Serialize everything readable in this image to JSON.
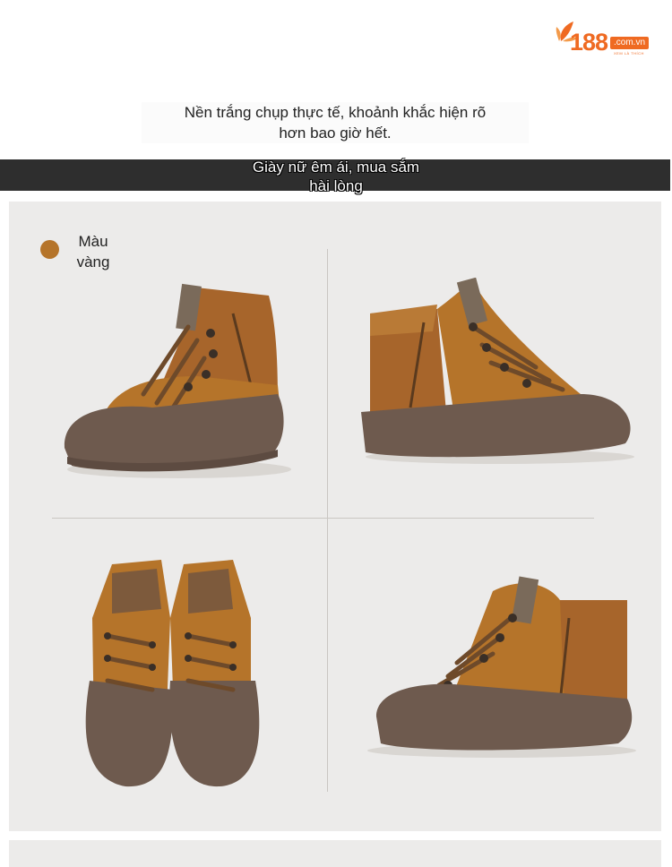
{
  "logo": {
    "number": "188",
    "domain": ".com.vn",
    "tagline": "XEM LÀ THÍCH",
    "brand_color": "#ef6a22"
  },
  "caption": {
    "line1": "Nền trắng chụp thực tế, khoảnh khắc hiện rõ",
    "line2": "hơn bao giờ hết."
  },
  "banner": {
    "line1": "Giày nữ êm ái, mua sắm",
    "line2": "hài lòng"
  },
  "color_option": {
    "label_line1": "Màu",
    "label_line2": "vàng",
    "swatch_color": "#b5742a"
  },
  "photos": [
    {
      "view": "side-front-left"
    },
    {
      "view": "side-right"
    },
    {
      "view": "front-pair"
    },
    {
      "view": "side-front-right"
    }
  ]
}
